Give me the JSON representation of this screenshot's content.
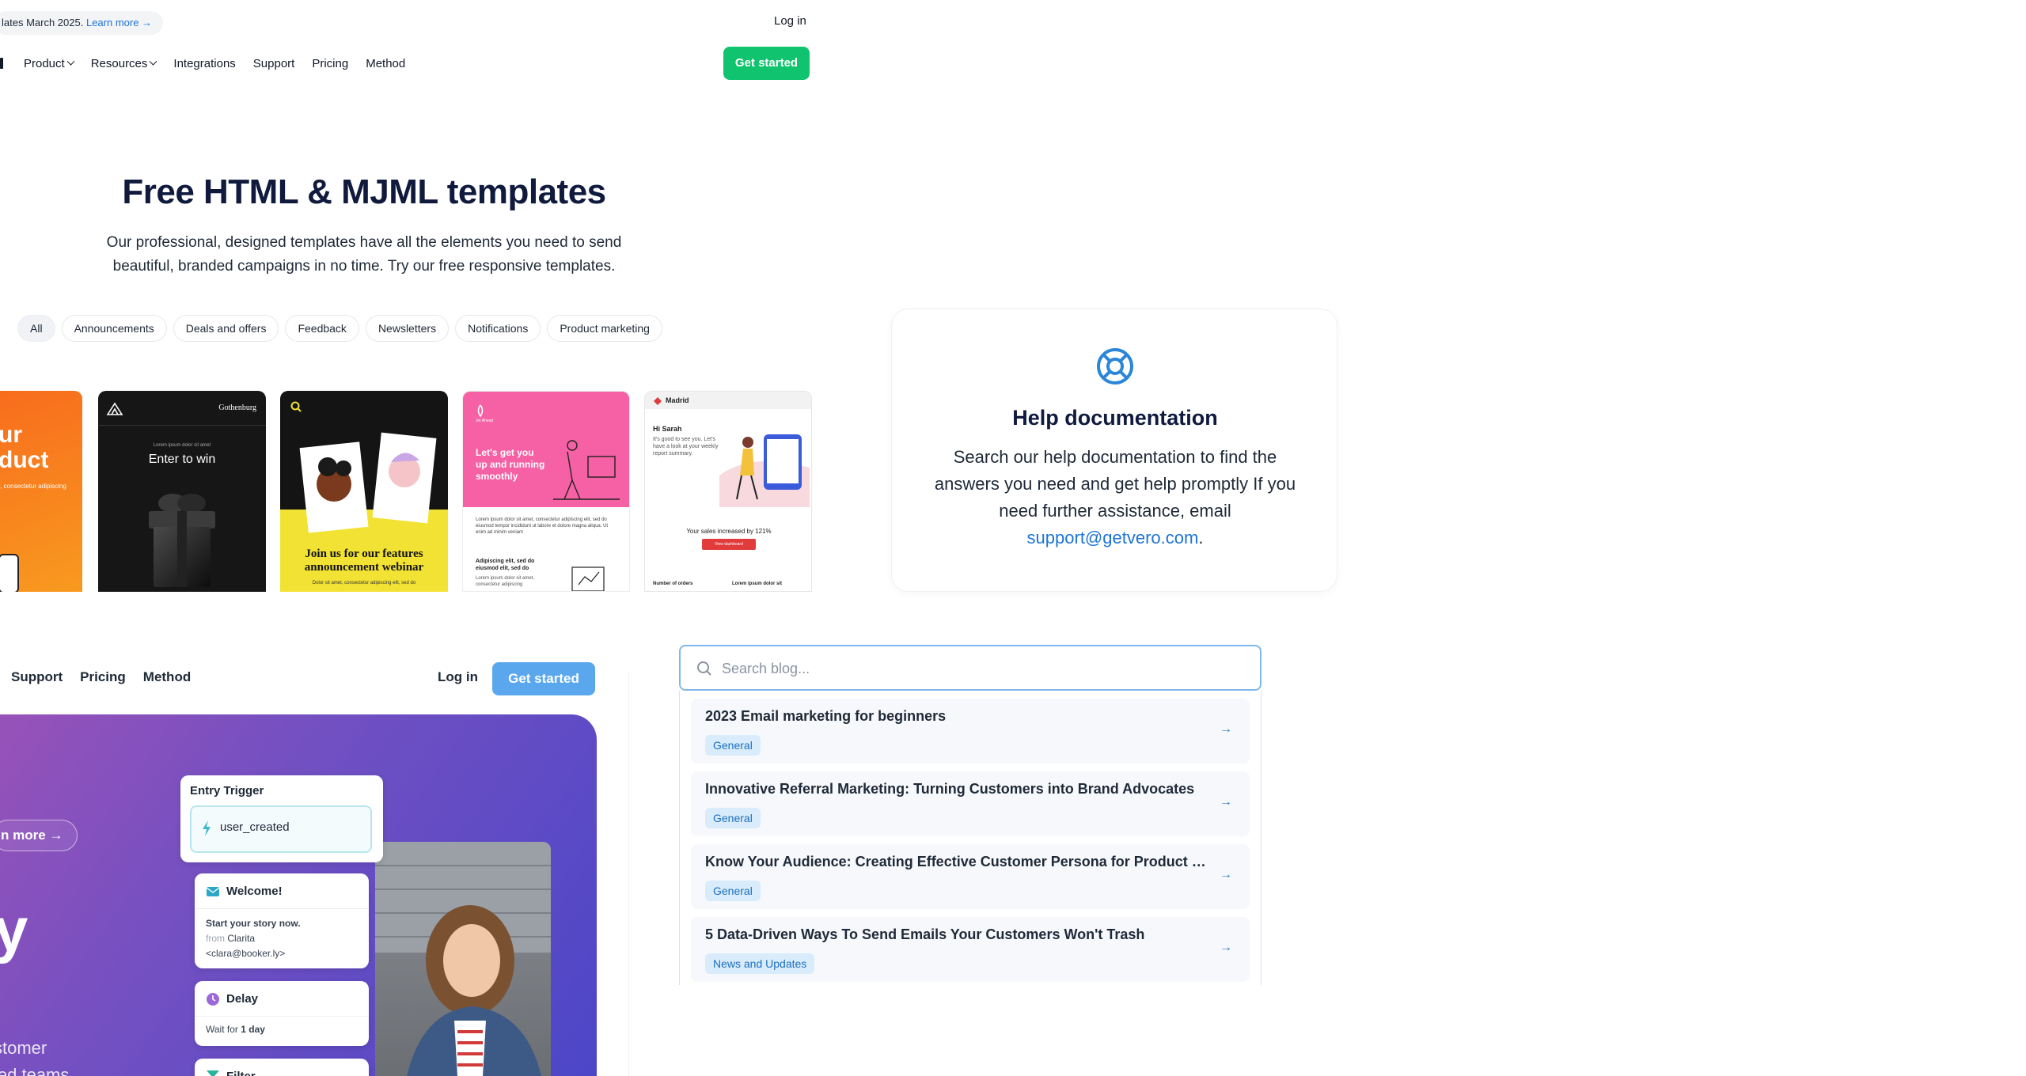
{
  "top": {
    "announcement_text": "lates March 2025.",
    "announcement_link": "Learn more →",
    "login": "Log in",
    "get_started": "Get started",
    "nav": [
      "Product",
      "Resources",
      "Integrations",
      "Support",
      "Pricing",
      "Method"
    ]
  },
  "hero": {
    "title": "Free HTML & MJML templates",
    "subtitle": "Our professional, designed templates have all the elements you need to send beautiful, branded campaigns in no time. Try our free responsive templates."
  },
  "filters": [
    "All",
    "Announcements",
    "Deals and offers",
    "Feedback",
    "Newsletters",
    "Notifications",
    "Product marketing"
  ],
  "templates": {
    "t1": {
      "line1": "ur",
      "line2": "duct",
      "small": "t, consectetur adipiscing"
    },
    "t2": {
      "brand": "Gothenburg",
      "small": "Lorem ipsum dolor sit amet",
      "headline": "Enter to win"
    },
    "t3": {
      "headline": "Join us for our features announcement webinar",
      "small": "Dolor sit amet, consectetur adipiscing elit, sed do"
    },
    "t4": {
      "brand": "Jet Ahead",
      "headline": "Let's get you up and running smoothly",
      "body": "Lorem ipsum dolor sit amet, consectetur adipiscing elit, sed do eiusmod tempor incididunt ut labore et dolore magna aliqua. Ut enim ad minim veniam",
      "sub": "Adipiscing elit, sed do eiusmod elit, sed do",
      "small": "Lorem ipsum dolor sit amet, consectetur adipiscing"
    },
    "t5": {
      "brand": "Madrid",
      "greeting": "Hi Sarah",
      "body": "It's good to see you. Let's have a look at your weekly report summary.",
      "sales": "Your sales increased by 121%",
      "cta": "View dashboard",
      "col1": "Number of orders",
      "col2": "Lorem ipsum dolor sit"
    }
  },
  "help": {
    "title": "Help documentation",
    "text": "Search our help documentation to find the answers you need and get help promptly If you need further assistance, email",
    "email": "support@getvero.com",
    "period": "."
  },
  "lower": {
    "nav": [
      "Support",
      "Pricing",
      "Method"
    ],
    "login": "Log in",
    "get_started": "Get started",
    "learn_more": "n more →",
    "big_letter": "y",
    "line1": "stomer",
    "line2": "ied teams."
  },
  "flow": {
    "entry_label": "Entry Trigger",
    "entry_value": "user_created",
    "welcome_title": "Welcome!",
    "welcome_line1": "Start your story now.",
    "welcome_from": "from",
    "welcome_name": "Clarita",
    "welcome_email": "<clara@booker.ly>",
    "delay_title": "Delay",
    "delay_prefix": "Wait for",
    "delay_value": "1 day",
    "filter_title": "Filter"
  },
  "blog": {
    "placeholder": "Search blog...",
    "results": [
      {
        "title": "2023 Email marketing for beginners",
        "tag": "General"
      },
      {
        "title": "Innovative Referral Marketing: Turning Customers into Brand Advocates",
        "tag": "General"
      },
      {
        "title": "Know Your Audience: Creating Effective Customer Persona for Product M...",
        "tag": "General"
      },
      {
        "title": "5 Data-Driven Ways To Send Emails Your Customers Won't Trash",
        "tag": "News and Updates"
      }
    ]
  },
  "colors": {
    "green": "#10c46f",
    "blue_button": "#5aa7ee",
    "link": "#1d74d8",
    "navy": "#0f1a3d"
  }
}
